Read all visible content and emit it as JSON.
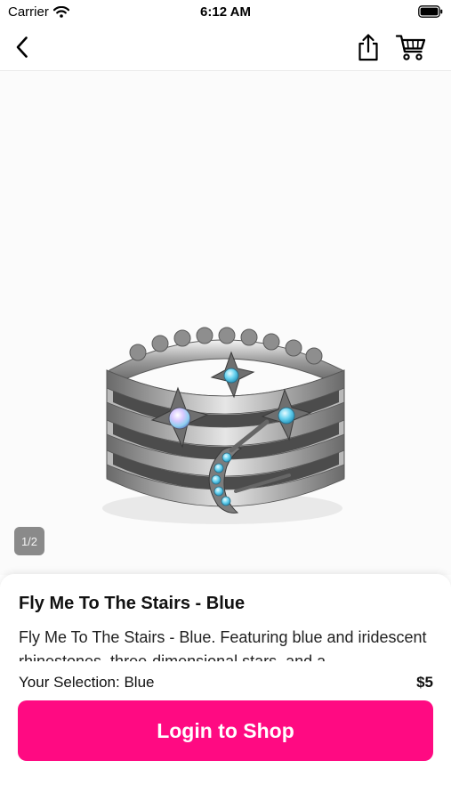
{
  "status_bar": {
    "carrier": "Carrier",
    "time": "6:12 AM",
    "icons": [
      "wifi-icon",
      "battery-icon"
    ]
  },
  "nav_bar": {
    "icons": [
      "back-chevron-icon",
      "share-icon",
      "cart-icon"
    ]
  },
  "gallery": {
    "image_subject": "silver ring with blue rhinestone stars and moon",
    "page_indicator": "1/2"
  },
  "product": {
    "title": "Fly Me To The Stairs - Blue",
    "description": "Fly Me To The Stairs - Blue. Featuring blue and iridescent rhinestones, three-dimensional stars, and a"
  },
  "purchase": {
    "selection": "Your Selection: Blue",
    "price": "$5",
    "login_label": "Login to Shop"
  },
  "colors": {
    "accent": "#ff0a82",
    "page_indicator_bg": "#8a8a8a",
    "gallery_bg": "#fbfbfb"
  }
}
